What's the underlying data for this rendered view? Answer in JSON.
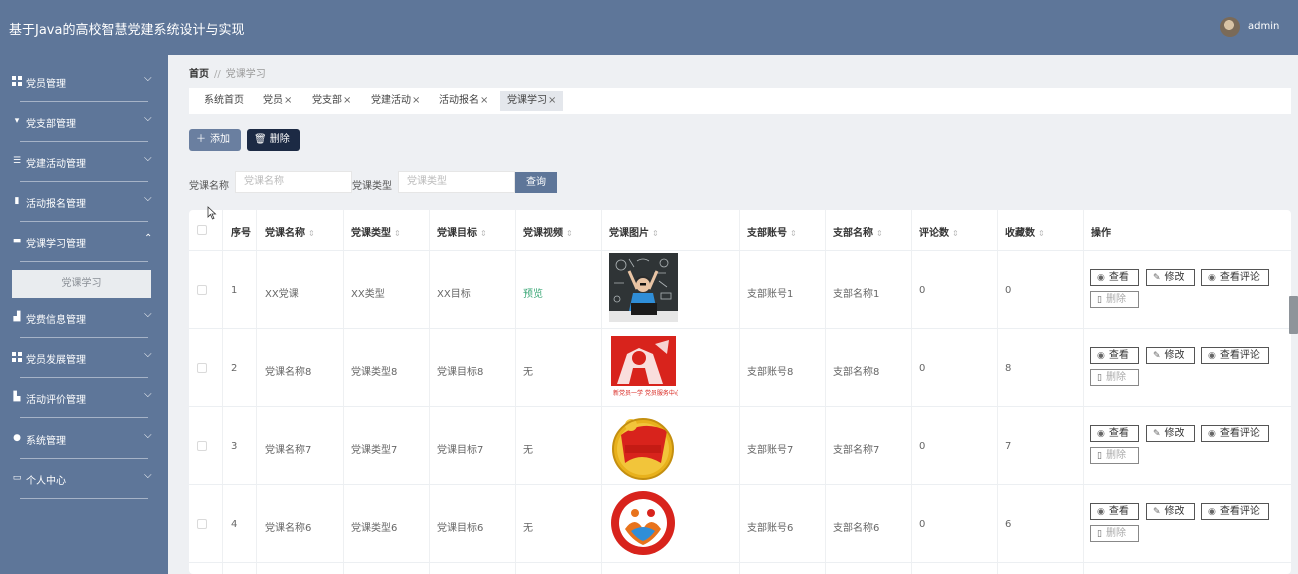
{
  "app": {
    "title": "基于Java的高校智慧党建系统设计与实现",
    "user": "admin"
  },
  "sidebar": {
    "items": [
      {
        "label": "党员管理",
        "icon": "grid-icon"
      },
      {
        "label": "党支部管理",
        "icon": "pin-icon"
      },
      {
        "label": "党建活动管理",
        "icon": "sliders-icon"
      },
      {
        "label": "活动报名管理",
        "icon": "clipboard-icon"
      },
      {
        "label": "党课学习管理",
        "icon": "ticket-icon"
      },
      {
        "label": "党费信息管理",
        "icon": "thumbs-up-icon"
      },
      {
        "label": "党员发展管理",
        "icon": "grid-icon"
      },
      {
        "label": "活动评价管理",
        "icon": "chart-icon"
      },
      {
        "label": "系统管理",
        "icon": "user-icon"
      },
      {
        "label": "个人中心",
        "icon": "window-icon"
      }
    ],
    "submenu": "党课学习"
  },
  "breadcrumb": {
    "home": "首页",
    "sep": "//",
    "current": "党课学习"
  },
  "tabs": [
    {
      "label": "系统首页",
      "close": ""
    },
    {
      "label": "党员",
      "close": "×"
    },
    {
      "label": "党支部",
      "close": "×"
    },
    {
      "label": "党建活动",
      "close": "×"
    },
    {
      "label": "活动报名",
      "close": "×"
    },
    {
      "label": "党课学习",
      "close": "×"
    }
  ],
  "toolbar": {
    "add": "添加",
    "delete": "删除"
  },
  "search": {
    "name_label": "党课名称",
    "name_placeholder": "党课名称",
    "type_label": "党课类型",
    "type_placeholder": "党课类型",
    "button": "查询"
  },
  "table": {
    "headers": [
      "序号",
      "党课名称",
      "党课类型",
      "党课目标",
      "党课视频",
      "党课图片",
      "支部账号",
      "支部名称",
      "评论数",
      "收藏数",
      "操作"
    ],
    "actions": {
      "view": "查看",
      "edit": "修改",
      "comments": "查看评论",
      "delete": "删除"
    },
    "rows": [
      {
        "no": "1",
        "name": "XX党课",
        "type": "XX类型",
        "goal": "XX目标",
        "video": "预览",
        "account": "支部账号1",
        "branch": "支部名称1",
        "comments": "0",
        "favorites": "0",
        "image": "classroom-photo"
      },
      {
        "no": "2",
        "name": "党课名称8",
        "type": "党课类型8",
        "goal": "党课目标8",
        "video": "无",
        "account": "支部账号8",
        "branch": "支部名称8",
        "comments": "0",
        "favorites": "8",
        "image": "red-poster",
        "caption": "新党员一学 党员服务中心"
      },
      {
        "no": "3",
        "name": "党课名称7",
        "type": "党课类型7",
        "goal": "党课目标7",
        "video": "无",
        "account": "支部账号7",
        "branch": "支部名称7",
        "comments": "0",
        "favorites": "7",
        "image": "youth-league-badge"
      },
      {
        "no": "4",
        "name": "党课名称6",
        "type": "党课类型6",
        "goal": "党课目标6",
        "video": "无",
        "account": "支部账号6",
        "branch": "支部名称6",
        "comments": "0",
        "favorites": "6",
        "image": "volunteer-logo"
      }
    ]
  },
  "colors": {
    "header": "#5e7699",
    "sidebar": "#5e7699",
    "add_button": "#6a7fa0",
    "delete_button": "#1c2a44",
    "preview_link": "#3aa776"
  }
}
